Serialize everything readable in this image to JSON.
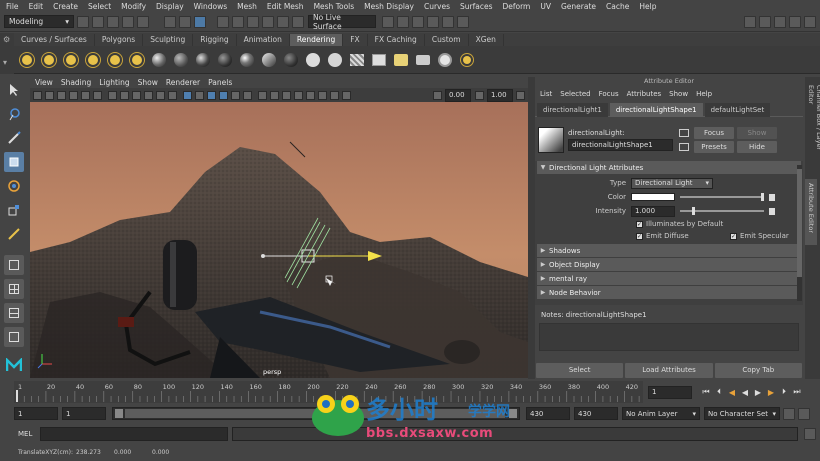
{
  "menubar": [
    "File",
    "Edit",
    "Create",
    "Select",
    "Modify",
    "Display",
    "Windows",
    "Mesh",
    "Edit Mesh",
    "Mesh Tools",
    "Mesh Display",
    "Curves",
    "Surfaces",
    "Deform",
    "UV",
    "Generate",
    "Cache",
    "Help"
  ],
  "status": {
    "mode": "Modeling",
    "live_surface": "No Live Surface"
  },
  "shelf_tabs": [
    "Curves / Surfaces",
    "Polygons",
    "Sculpting",
    "Rigging",
    "Animation",
    "Rendering",
    "FX",
    "FX Caching",
    "Custom",
    "XGen"
  ],
  "shelf_active": "Rendering",
  "viewport": {
    "menu": [
      "View",
      "Shading",
      "Lighting",
      "Show",
      "Renderer",
      "Panels"
    ],
    "exposure": "0.00",
    "gamma": "1.00",
    "camera_label": "persp"
  },
  "attribute_editor": {
    "title": "Attribute Editor",
    "menu": [
      "List",
      "Selected",
      "Focus",
      "Attributes",
      "Show",
      "Help"
    ],
    "tabs": [
      "directionalLight1",
      "directionalLightShape1",
      "defaultLightSet"
    ],
    "active_tab": "directionalLightShape1",
    "node_type_label": "directionalLight:",
    "node_name": "directionalLightShape1",
    "buttons": {
      "focus": "Focus",
      "show": "Show",
      "presets": "Presets",
      "hide": "Hide"
    },
    "section_main": "Directional Light Attributes",
    "type_label": "Type",
    "type_value": "Directional Light",
    "color_label": "Color",
    "intensity_label": "Intensity",
    "intensity_value": "1.000",
    "illuminates_default": "Illuminates by Default",
    "emit_diffuse": "Emit Diffuse",
    "emit_specular": "Emit Specular",
    "collapsed_sections": [
      "Shadows",
      "Object Display",
      "mental ray",
      "Node Behavior"
    ],
    "notes": "Notes:  directionalLightShape1",
    "footer": {
      "select": "Select",
      "load": "Load Attributes",
      "copy": "Copy Tab"
    }
  },
  "side_tabs": [
    "Channel Box / Layer Editor",
    "Attribute Editor"
  ],
  "timeline": {
    "ticks": [
      "1",
      "20",
      "40",
      "60",
      "80",
      "100",
      "120",
      "140",
      "160",
      "180",
      "200",
      "220",
      "240",
      "260",
      "280",
      "300",
      "320",
      "340",
      "360",
      "380",
      "400",
      "420"
    ],
    "current_frame": "1"
  },
  "range": {
    "start": "1",
    "start2": "1",
    "slider_value": "1",
    "end": "430",
    "end2": "430",
    "anim_layer": "No Anim Layer",
    "character_set": "No Character Set"
  },
  "mel_label": "MEL",
  "help_line": {
    "label": "TranslateXYZ(cm):",
    "x": "238.273",
    "y": "0.000",
    "z": "0.000"
  },
  "watermark": {
    "site": "bbs.dxsaxw.com"
  },
  "colors": {
    "accent_blue": "#5a7fa5",
    "bg": "#444444",
    "sky": "#b57d5f",
    "rock": "#3d3836"
  }
}
